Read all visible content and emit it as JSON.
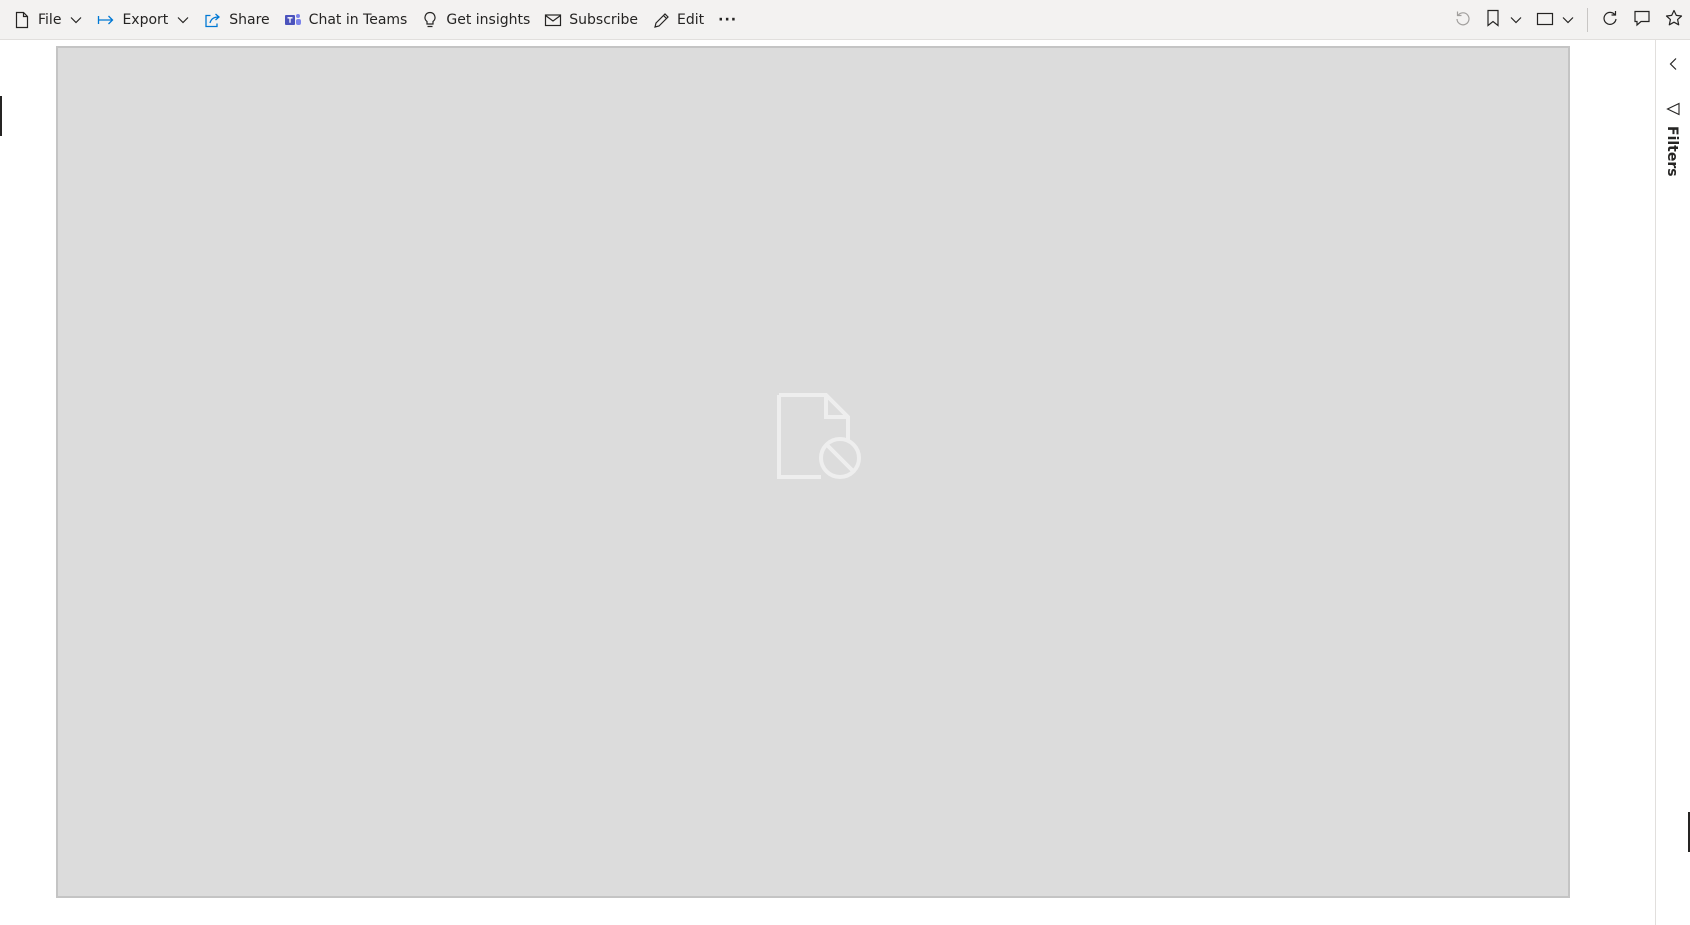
{
  "toolbar": {
    "file_label": "File",
    "export_label": "Export",
    "share_label": "Share",
    "teams_label": "Chat in Teams",
    "insights_label": "Get insights",
    "subscribe_label": "Subscribe",
    "edit_label": "Edit",
    "more_label": "···"
  },
  "filters": {
    "label": "Filters"
  },
  "icons": {
    "file": "file-icon",
    "export": "export-arrow-icon",
    "share": "share-icon",
    "teams": "teams-icon",
    "insights": "lightbulb-icon",
    "subscribe": "mail-icon",
    "edit": "pencil-icon",
    "reset": "undo-icon",
    "bookmark": "bookmark-icon",
    "view": "view-icon",
    "refresh": "refresh-icon",
    "comment": "comment-icon",
    "favorite": "star-icon",
    "blocked": "blocked-file-icon"
  },
  "colors": {
    "toolbar_bg": "#f3f2f1",
    "canvas_bg": "#dcdcdc",
    "teams_accent": "#4b53bc",
    "export_accent": "#0078d4"
  }
}
